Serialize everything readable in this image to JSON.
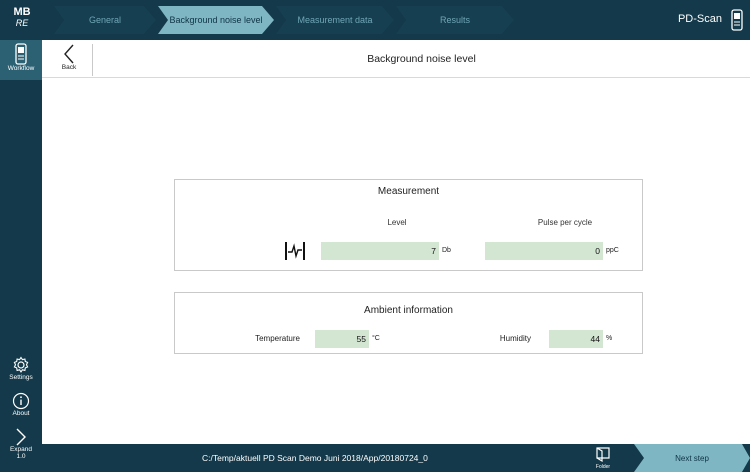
{
  "app": {
    "logo_line1": "MB",
    "logo_line2": "RE",
    "title": "PD-Scan"
  },
  "workflow_steps": [
    {
      "label": "General",
      "active": false
    },
    {
      "label": "Background noise level",
      "active": true
    },
    {
      "label": "Measurement data",
      "active": false
    },
    {
      "label": "Results",
      "active": false
    }
  ],
  "sidebar": {
    "workflow_label": "Workflow",
    "settings_label": "Settings",
    "about_label": "About",
    "expand_label": "Expand",
    "version": "1.0"
  },
  "header": {
    "back_label": "Back",
    "page_title": "Background noise level"
  },
  "measurement": {
    "title": "Measurement",
    "level_header": "Level",
    "ppc_header": "Pulse per cycle",
    "level_value": "7",
    "level_unit": "Db",
    "ppc_value": "0",
    "ppc_unit": "ppC"
  },
  "ambient": {
    "title": "Ambient information",
    "temperature_label": "Temperature",
    "temperature_value": "55",
    "temperature_unit": "°C",
    "humidity_label": "Humidity",
    "humidity_value": "44",
    "humidity_unit": "%"
  },
  "footer": {
    "path": "C:/Temp/aktuell PD Scan Demo Juni 2018/App/20180724_0",
    "folder_label": "Folder",
    "next_label": "Next step"
  },
  "colors": {
    "dark_navy": "#13394a",
    "active_step": "#7fb6c4",
    "field_green": "#d3e6d2"
  }
}
